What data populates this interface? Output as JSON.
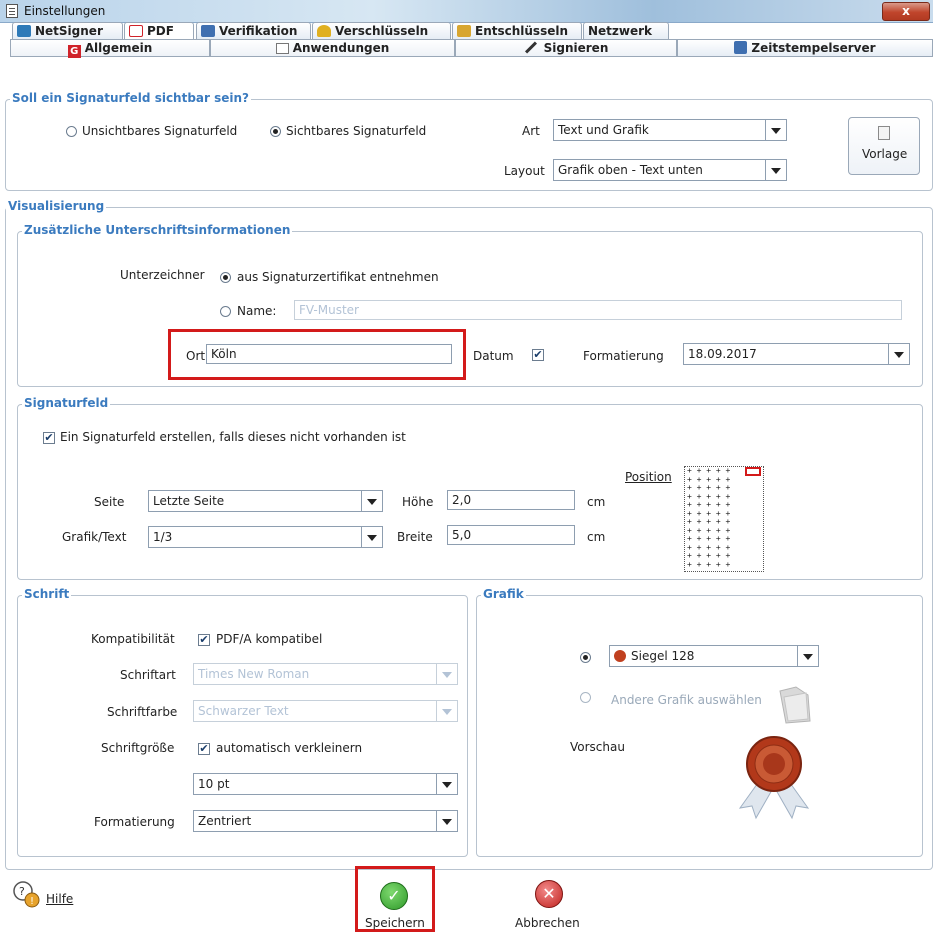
{
  "window": {
    "title": "Einstellungen",
    "close_label": "x"
  },
  "tabs_top": [
    {
      "label": "NetSigner",
      "color": "#2e7ab8"
    },
    {
      "label": "PDF",
      "color": "#d0232a"
    },
    {
      "label": "Verifikation",
      "color": "#3f6fb0"
    },
    {
      "label": "Verschlüsseln",
      "color": "#e0b020"
    },
    {
      "label": "Entschlüsseln",
      "color": "#d8a630"
    },
    {
      "label": "Netzwerk",
      "color": ""
    }
  ],
  "tabs_sub": [
    {
      "label": "Allgemein"
    },
    {
      "label": "Anwendungen"
    },
    {
      "label": "Signieren"
    },
    {
      "label": "Zeitstempelserver"
    }
  ],
  "visibility": {
    "title": "Soll ein Signaturfeld sichtbar sein?",
    "invisible_label": "Unsichtbares Signaturfeld",
    "visible_label": "Sichtbares Signaturfeld",
    "art_label": "Art",
    "art_value": "Text und Grafik",
    "layout_label": "Layout",
    "layout_value": "Grafik oben - Text unten",
    "vorlage_label": "Vorlage"
  },
  "visualisierung": {
    "title": "Visualisierung",
    "info_title": "Zusätzliche Unterschriftsinformationen",
    "unterzeichner_label": "Unterzeichner",
    "from_cert_label": "aus Signaturzertifikat entnehmen",
    "name_label": "Name:",
    "name_placeholder": "FV-Muster",
    "ort_label": "Ort",
    "ort_value": "Köln",
    "datum_label": "Datum",
    "formatierung_label": "Formatierung",
    "formatierung_value": "18.09.2017"
  },
  "signaturfeld": {
    "title": "Signaturfeld",
    "create_label": "Ein Signaturfeld erstellen, falls dieses nicht vorhanden ist",
    "position_label": "Position",
    "seite_label": "Seite",
    "seite_value": "Letzte Seite",
    "grafik_text_label": "Grafik/Text",
    "grafik_text_value": "1/3",
    "hoehe_label": "Höhe",
    "hoehe_value": "2,0",
    "breite_label": "Breite",
    "breite_value": "5,0",
    "unit_cm": "cm"
  },
  "schrift": {
    "title": "Schrift",
    "kompatibilitaet_label": "Kompatibilität",
    "pdfa_label": "PDF/A kompatibel",
    "schriftart_label": "Schriftart",
    "schriftart_value": "Times New Roman",
    "schriftfarbe_label": "Schriftfarbe",
    "schriftfarbe_value": "Schwarzer Text",
    "schriftgroesse_label": "Schriftgröße",
    "auto_label": "automatisch verkleinern",
    "size_value": "10 pt",
    "formatierung_label": "Formatierung",
    "formatierung_value": "Zentriert"
  },
  "grafik": {
    "title": "Grafik",
    "siegel_value": "Siegel 128",
    "other_label": "Andere Grafik auswählen",
    "vorschau_label": "Vorschau"
  },
  "footer": {
    "help_label": "Hilfe",
    "save_label": "Speichern",
    "cancel_label": "Abbrechen"
  },
  "position_grid": "+ + + + +\n+ + + + +\n+ + + + +\n+ + + + +\n+ + + + +\n+ + + + +\n+ + + + +\n+ + + + +\n+ + + + +\n+ + + + +\n+ + + + +\n+ + + + +"
}
